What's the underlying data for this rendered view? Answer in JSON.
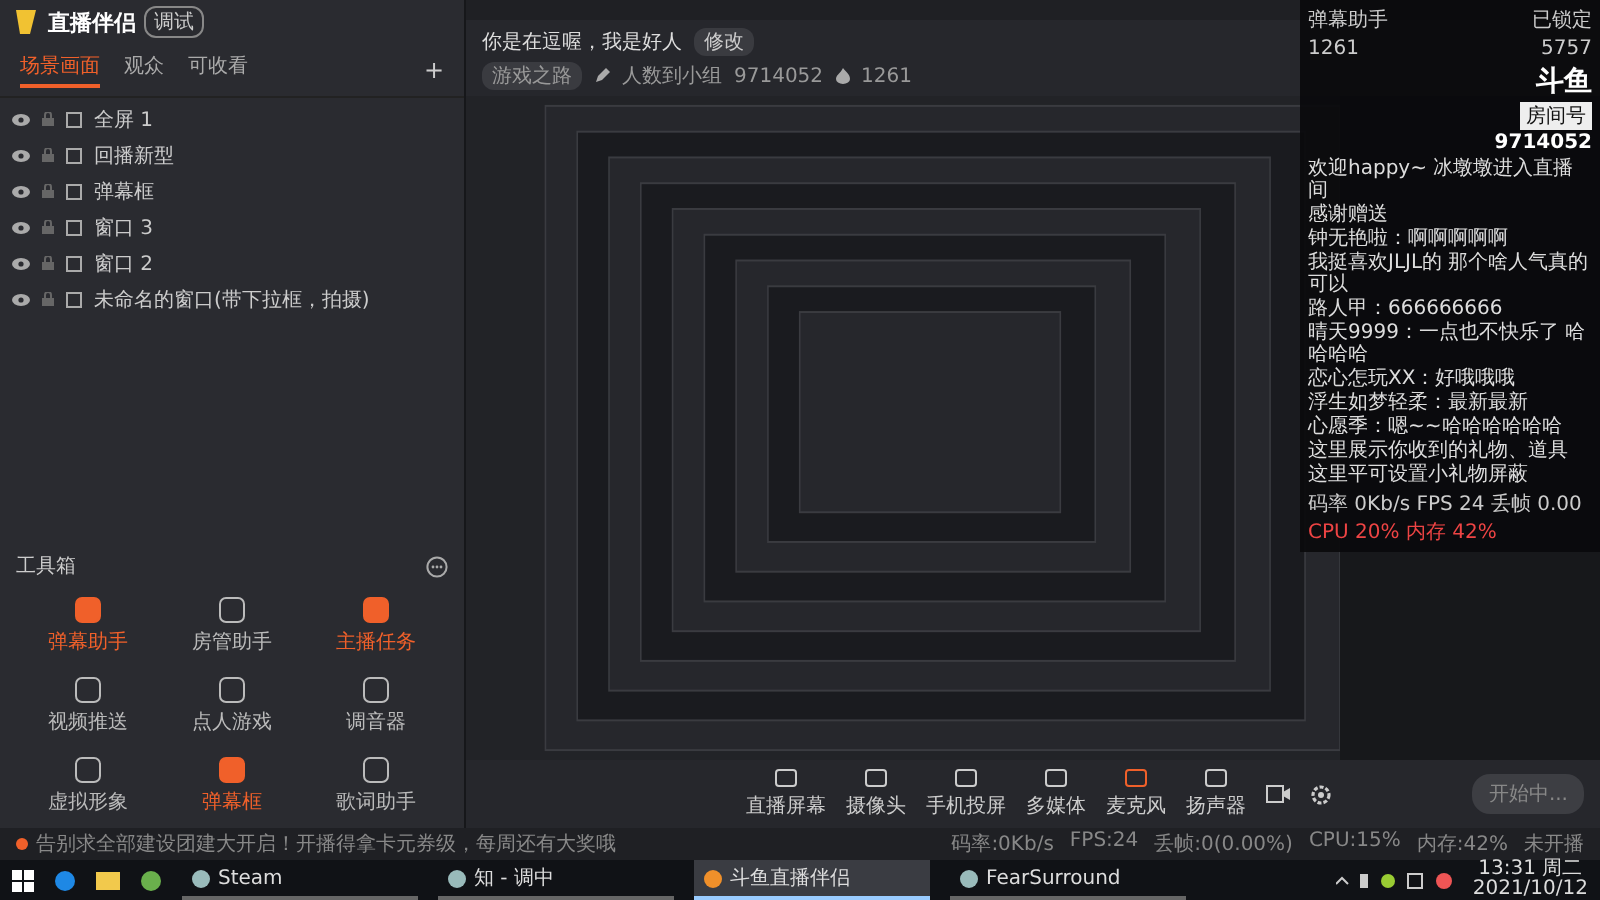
{
  "app": {
    "logo": "直播伴侣",
    "badge": "调试"
  },
  "tabs": [
    {
      "label": "场景画面",
      "selected": true
    },
    {
      "label": "观众",
      "selected": false
    },
    {
      "label": "可收看",
      "selected": false
    }
  ],
  "add_symbol": "+",
  "scenes": [
    {
      "name": "全屏 1"
    },
    {
      "name": "回播新型"
    },
    {
      "name": "弹幕框"
    },
    {
      "name": "窗口 3"
    },
    {
      "name": "窗口 2"
    },
    {
      "name": "未命名的窗口(带下拉框，拍摄)"
    }
  ],
  "toolbox": {
    "title": "工具箱",
    "items": [
      {
        "label": "弹幕助手",
        "highlighted": true
      },
      {
        "label": "房管助手",
        "highlighted": false
      },
      {
        "label": "主播任务",
        "highlighted": true
      },
      {
        "label": "视频推送",
        "highlighted": false
      },
      {
        "label": "点人游戏",
        "highlighted": false
      },
      {
        "label": "调音器",
        "highlighted": false
      },
      {
        "label": "虚拟形象",
        "highlighted": false
      },
      {
        "label": "弹幕框",
        "highlighted": true
      },
      {
        "label": "歌词助手",
        "highlighted": false
      }
    ]
  },
  "header": {
    "title": "你是在逗喔，我是好人",
    "edit_button": "修改",
    "category": "游戏之路",
    "group": "人数到小组",
    "room": "9714052",
    "heat": "1261"
  },
  "chat": {
    "title": "弹幕助手",
    "lock": "已锁定",
    "likes": "1261",
    "gifts": "5757",
    "logo": "斗鱼",
    "room_label": "房间号",
    "room": "9714052",
    "messages": [
      "欢迎happy~ 冰墩墩进入直播间",
      "感谢赠送",
      "钟无艳啦：啊啊啊啊啊",
      "我挺喜欢JLJL的 那个啥人气真的可以",
      "路人甲：666666666",
      "晴天9999：一点也不快乐了 哈哈哈哈",
      "恋心怎玩XX：好哦哦哦",
      "浮生如梦轻柔：最新最新",
      "心愿季：嗯~~哈哈哈哈哈哈",
      "这里展示你收到的礼物、道具",
      "这里平可设置小礼物屏蔽"
    ],
    "stats_left": "码率 0Kb/s FPS 24 丢帧 0.00",
    "stats_right": "CPU 20% 内存 42%"
  },
  "controls": [
    {
      "label": "直播屏幕"
    },
    {
      "label": "摄像头"
    },
    {
      "label": "手机投屏"
    },
    {
      "label": "多媒体"
    },
    {
      "label": "麦克风"
    },
    {
      "label": "扬声器"
    }
  ],
  "start_button": "开始中...",
  "notice": "告别求全部建设团建大开启！开播得拿卡元券级，每周还有大奖哦",
  "status": [
    "码率:0Kb/s",
    "FPS:24",
    "丢帧:0(0.00%)",
    "CPU:15%",
    "内存:42%",
    "未开播"
  ],
  "taskbar": {
    "apps": [
      {
        "label": "Steam",
        "selected": false
      },
      {
        "label": "知 - 调中",
        "selected": false
      },
      {
        "label": "斗鱼直播伴侣",
        "selected": true
      },
      {
        "label": "FearSurround",
        "selected": false
      }
    ],
    "time": "13:31 周二",
    "date": "2021/10/12"
  }
}
